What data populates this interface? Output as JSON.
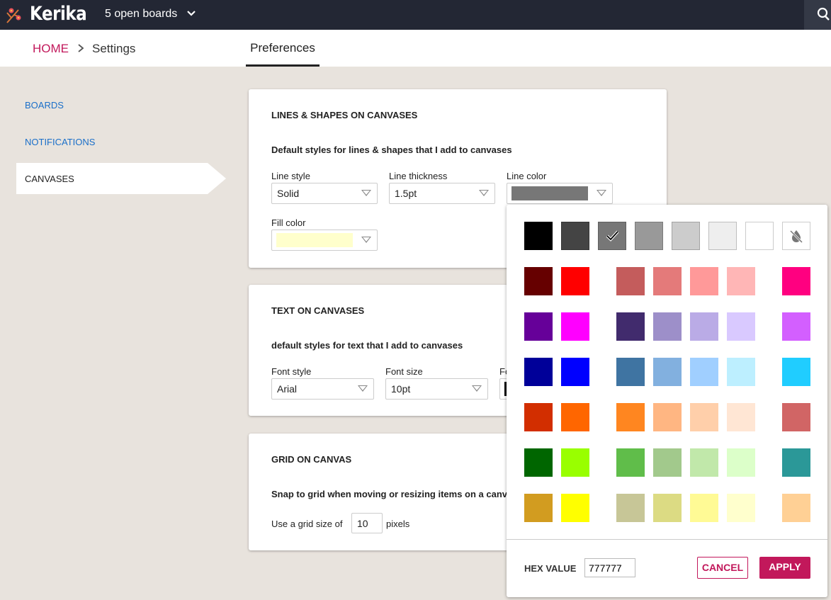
{
  "topbar": {
    "logo": "Kerika",
    "boards_label": "5 open boards"
  },
  "breadcrumb": {
    "home": "HOME",
    "current": "Settings"
  },
  "tab": "Preferences",
  "sidebar": {
    "items": [
      {
        "label": "BOARDS"
      },
      {
        "label": "NOTIFICATIONS"
      },
      {
        "label": "CANVASES"
      }
    ]
  },
  "cards": {
    "lines": {
      "title": "LINES & SHAPES ON CANVASES",
      "subtitle": "Default styles for lines & shapes that I add to canvases",
      "line_style_label": "Line style",
      "line_style": "Solid",
      "line_thickness_label": "Line thickness",
      "line_thickness": "1.5pt",
      "line_color_label": "Line color",
      "line_color": "#777777",
      "fill_color_label": "Fill color",
      "fill_color": "#ffffcc"
    },
    "text": {
      "title": "TEXT ON CANVASES",
      "subtitle": "default styles for text that I add to canvases",
      "font_style_label": "Font style",
      "font_style": "Arial",
      "font_size_label": "Font size",
      "font_size": "10pt",
      "font_color_label": "Font color"
    },
    "grid": {
      "title": "GRID ON CANVAS",
      "subtitle": "Snap to grid when moving or resizing items on a canvas",
      "grid_prefix": "Use a grid size of",
      "grid_size": "10",
      "grid_suffix": "pixels"
    }
  },
  "color_picker": {
    "selected": "#777777",
    "rows": [
      [
        "#000000",
        "#444444",
        "#777777",
        "#999999",
        "#cccccc",
        "#eeeeee",
        "#ffffff",
        "none"
      ],
      [
        "#660000",
        "#ff0000",
        "#c45c5c",
        "#e47a7a",
        "#ff9999",
        "#ffb6b6",
        "#ff0080"
      ],
      [
        "#660099",
        "#ff00ff",
        "#412b6d",
        "#9d8fc9",
        "#baabe6",
        "#d9c9ff",
        "#d35fff"
      ],
      [
        "#000099",
        "#0000ff",
        "#3f74a2",
        "#82b0df",
        "#a0cfff",
        "#bdefff",
        "#20cdff"
      ],
      [
        "#d22e00",
        "#ff6600",
        "#ff8620",
        "#ffb682",
        "#ffcfaa",
        "#ffe6d4",
        "#d16565"
      ],
      [
        "#006600",
        "#99ff00",
        "#60bd4a",
        "#a2c98c",
        "#c1e8aa",
        "#dcffc9",
        "#2b9898"
      ],
      [
        "#d29c20",
        "#ffff00",
        "#c7c697",
        "#dcdb83",
        "#fffa95",
        "#ffffcd",
        "#ffd095"
      ]
    ],
    "hex_label": "HEX VALUE",
    "hex_value": "777777",
    "cancel": "CANCEL",
    "apply": "APPLY",
    "accent": "#c2185b"
  }
}
